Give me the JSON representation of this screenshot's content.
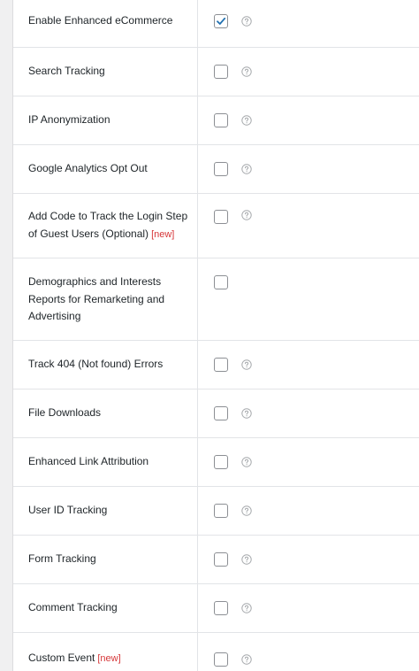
{
  "settings": {
    "rows": [
      {
        "label": "Enable Enhanced eCommerce",
        "new": "",
        "checked": true,
        "help": true
      },
      {
        "label": "Search Tracking",
        "new": "",
        "checked": false,
        "help": true
      },
      {
        "label": "IP Anonymization",
        "new": "",
        "checked": false,
        "help": true
      },
      {
        "label": "Google Analytics Opt Out",
        "new": "",
        "checked": false,
        "help": true
      },
      {
        "label": "Add Code to Track the Login Step of Guest Users (Optional)",
        "new": "[new]",
        "checked": false,
        "help": true
      },
      {
        "label": "Demographics and Interests Reports for Remarketing and Advertising",
        "new": "",
        "checked": false,
        "help": false
      },
      {
        "label": "Track 404 (Not found) Errors",
        "new": "",
        "checked": false,
        "help": true
      },
      {
        "label": "File Downloads",
        "new": "",
        "checked": false,
        "help": true
      },
      {
        "label": "Enhanced Link Attribution",
        "new": "",
        "checked": false,
        "help": true
      },
      {
        "label": "User ID Tracking",
        "new": "",
        "checked": false,
        "help": true
      },
      {
        "label": "Form Tracking",
        "new": "",
        "checked": false,
        "help": true
      },
      {
        "label": "Comment Tracking",
        "new": "",
        "checked": false,
        "help": true
      },
      {
        "label": "Custom Event",
        "new": "[new]",
        "checked": false,
        "help": true
      }
    ]
  },
  "colors": {
    "check": "#2271b1",
    "new_badge": "#d63638",
    "help_icon": "#a7aaad"
  },
  "icons": {
    "checkbox_checked": "checkmark-icon",
    "help": "question-circle-icon"
  }
}
